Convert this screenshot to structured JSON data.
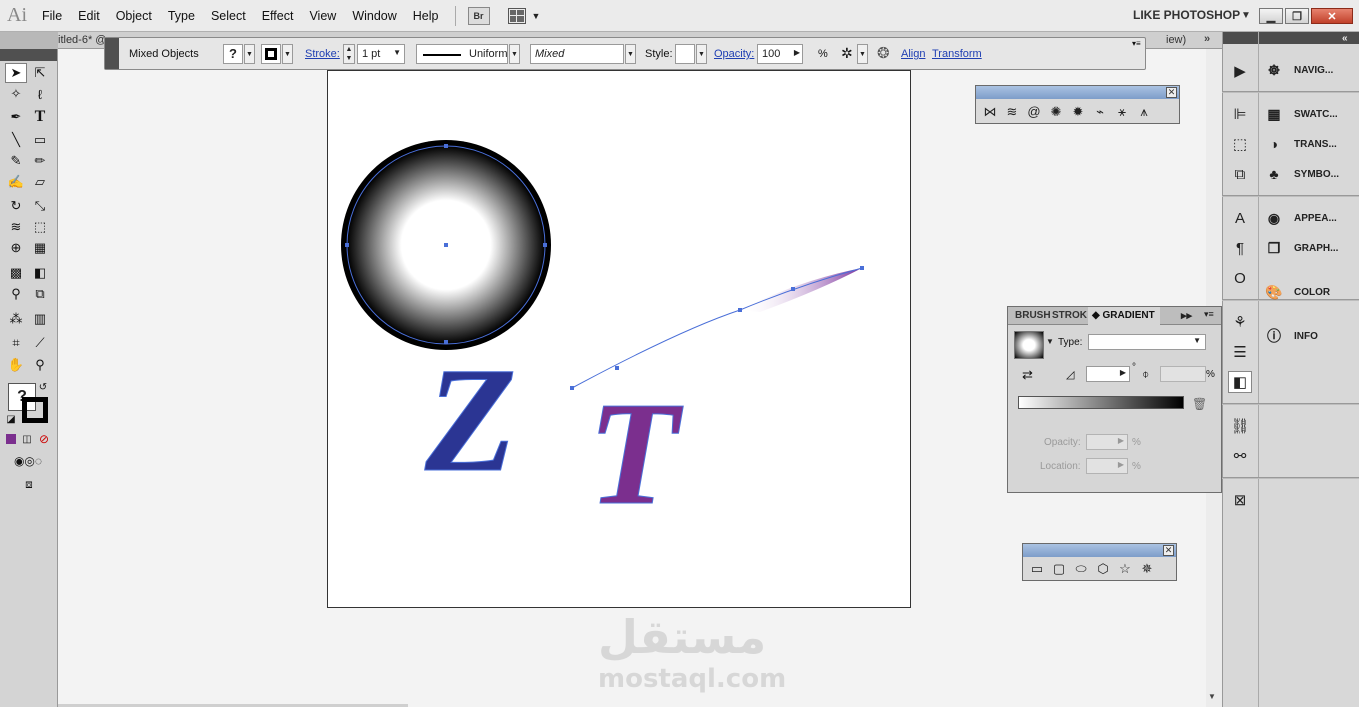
{
  "app": {
    "logo": "Ai",
    "workspace": "LIKE PHOTOSHOP"
  },
  "menu": [
    "File",
    "Edit",
    "Object",
    "Type",
    "Select",
    "Effect",
    "View",
    "Window",
    "Help"
  ],
  "bridge_label": "Br",
  "document": {
    "tab_title": "itled-6* @",
    "tab_right": "iew)"
  },
  "control": {
    "selection": "Mixed Objects",
    "fill_value": "?",
    "stroke_label": "Stroke:",
    "stroke_weight": "1 pt",
    "profile": "Uniform",
    "brush": "Mixed",
    "style_label": "Style:",
    "opacity_label": "Opacity:",
    "opacity_value": "100",
    "percent": "%",
    "align_label": "Align",
    "transform_label": "Transform"
  },
  "toolbox": {
    "fill_stroke_value": "?"
  },
  "dock_panels": [
    "NAVIG...",
    "SWATC...",
    "TRANS...",
    "SYMBO...",
    "APPEA...",
    "GRAPH...",
    "COLOR",
    "INFO"
  ],
  "gradient_panel": {
    "tabs": [
      "BRUSH",
      "STROK",
      "GRADIENT"
    ],
    "type_label": "Type:",
    "type_value": "",
    "percent": "%",
    "opacity_label": "Opacity:",
    "location_label": "Location:"
  },
  "artwork": {
    "letter_z": "Z",
    "letter_t": "T"
  },
  "watermark": {
    "arabic": "مستقل",
    "latin": "mostaql.com"
  },
  "colors": {
    "z_fill": "#2b3593",
    "t_fill": "#7b2f8e",
    "selection": "#4a6fd8"
  }
}
